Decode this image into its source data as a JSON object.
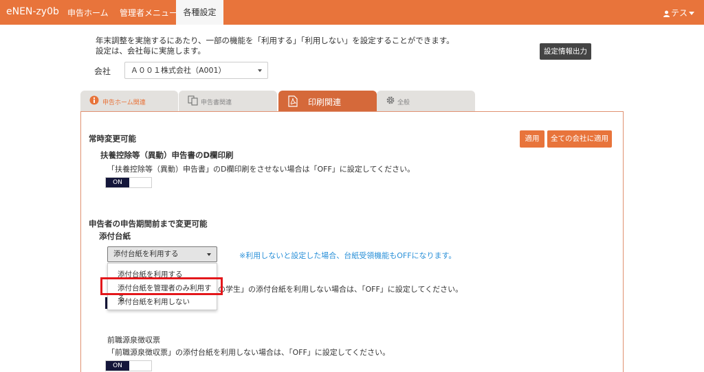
{
  "navbar": {
    "brand": "eNEN-zy0b",
    "items": [
      "申告ホーム",
      "管理者メニュー"
    ],
    "active": "各種設定",
    "user": "テス"
  },
  "intro": {
    "line1": "年末調整を実施するにあたり、一部の機能を「利用する」「利用しない」を設定することができます。",
    "line2": "設定は、会社毎に実施します。"
  },
  "export_button": "設定情報出力",
  "company": {
    "label": "会社",
    "value": "Ａ００１株式会社（A001）"
  },
  "tabs": [
    "申告ホーム関連",
    "申告書関連",
    "印刷関連",
    "全般"
  ],
  "active_tab": "印刷関連",
  "buttons": {
    "apply": "適用",
    "apply_all": "全ての会社に適用"
  },
  "section1": {
    "title": "常時変更可能",
    "item_title": "扶養控除等（異動）申告書のD欄印刷",
    "desc": "「扶養控除等（異動）申告書」のD欄印刷をさせない場合は「OFF」に設定してください。",
    "toggle": "ON"
  },
  "section2": {
    "title": "申告者の申告期間前まで変更可能",
    "item_title": "添付台紙",
    "select_value": "添付台紙を利用する",
    "note": "※利用しないと設定した場合、台紙受領機能もOFFになります。",
    "options": [
      "添付台紙を利用する",
      "添付台紙を管理者のみ利用する",
      "添付台紙を利用しない"
    ],
    "partial_desc": "の学生」の添付台紙を利用しない場合は、「OFF」に設定してください。",
    "sub_item_title": "前職源泉徴収票",
    "sub_desc": "「前職源泉徴収票」の添付台紙を利用しない場合は、「OFF」に設定してください。",
    "sub_toggle": "ON"
  }
}
